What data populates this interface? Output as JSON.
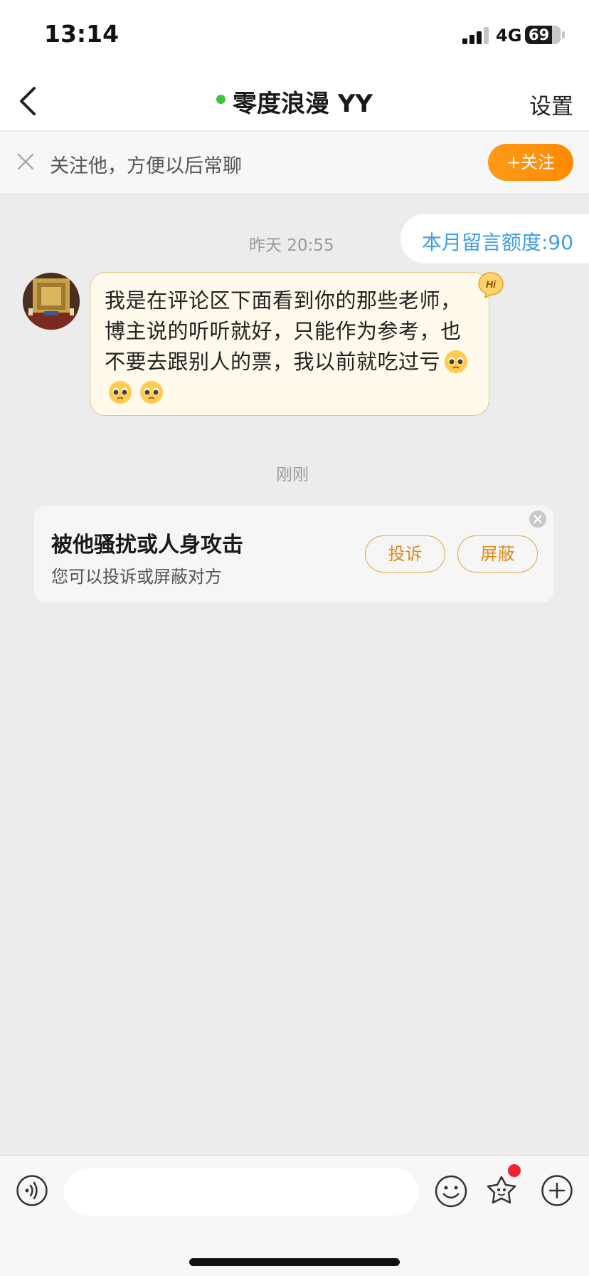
{
  "status_bar": {
    "time": "13:14",
    "network": "4G",
    "battery": "69"
  },
  "nav": {
    "title": "零度浪漫 YY",
    "settings_label": "设置",
    "online_color": "#3fc43f"
  },
  "follow_bar": {
    "text": "关注他，方便以后常聊",
    "button_label": "+关注"
  },
  "chat": {
    "timestamp_1": "昨天 20:55",
    "quota": "本月留言额度:90",
    "message": {
      "text": "我是在评论区下面看到你的那些老师，博主说的听听就好，只能作为参考，也不要去跟别人的票，我以前就吃过亏",
      "emojis": [
        "pleading-face",
        "pleading-face",
        "pleading-face"
      ],
      "badge": "Hi"
    },
    "timestamp_2": "刚刚",
    "report_card": {
      "title": "被他骚扰或人身攻击",
      "subtitle": "您可以投诉或屏蔽对方",
      "complain_label": "投诉",
      "block_label": "屏蔽"
    }
  },
  "input_bar": {
    "placeholder": "",
    "icons": [
      "voice-icon",
      "emoji-icon",
      "gift-icon",
      "plus-icon"
    ]
  },
  "colors": {
    "accent": "#ff8a00",
    "link_blue": "#3f9de6",
    "bubble_bg": "#fffaeb",
    "bubble_border": "#e9c37a"
  }
}
